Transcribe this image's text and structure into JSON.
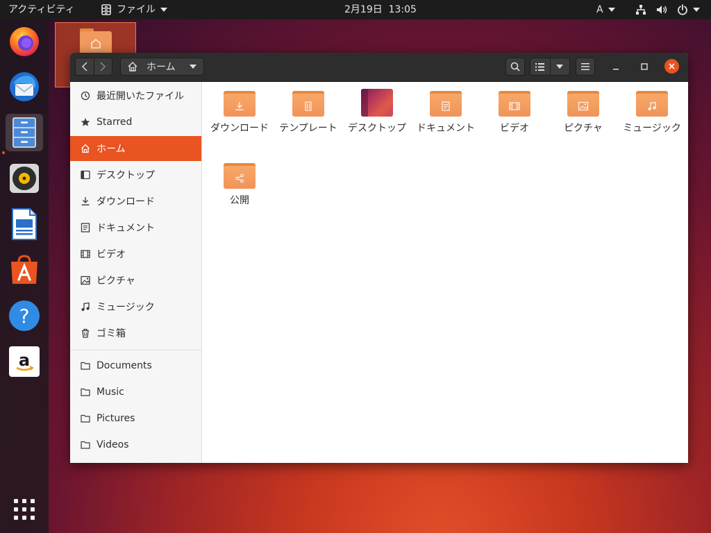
{
  "topbar": {
    "activities": "アクティビティ",
    "app_menu": "ファイル",
    "clock": "2月19日  13:05",
    "input_method": "A"
  },
  "dock": {
    "items": [
      {
        "icon": "firefox-icon"
      },
      {
        "icon": "thunderbird-icon"
      },
      {
        "icon": "files-icon",
        "active": true
      },
      {
        "icon": "rhythmbox-icon"
      },
      {
        "icon": "libreoffice-writer-icon"
      },
      {
        "icon": "ubuntu-software-icon"
      },
      {
        "icon": "help-icon"
      },
      {
        "icon": "amazon-icon"
      }
    ],
    "show_apps_icon": "app-grid-icon"
  },
  "window": {
    "location": "ホーム",
    "sidebar": {
      "items": [
        {
          "label": "最近開いたファイル",
          "icon": "recent-icon"
        },
        {
          "label": "Starred",
          "icon": "star-icon"
        },
        {
          "label": "ホーム",
          "icon": "home-icon",
          "selected": true
        },
        {
          "label": "デスクトップ",
          "icon": "desktop-icon"
        },
        {
          "label": "ダウンロード",
          "icon": "download-icon"
        },
        {
          "label": "ドキュメント",
          "icon": "document-icon"
        },
        {
          "label": "ビデオ",
          "icon": "video-icon"
        },
        {
          "label": "ピクチャ",
          "icon": "picture-icon"
        },
        {
          "label": "ミュージック",
          "icon": "music-icon"
        },
        {
          "label": "ゴミ箱",
          "icon": "trash-icon"
        },
        {
          "label": "Documents",
          "icon": "folder-icon"
        },
        {
          "label": "Music",
          "icon": "folder-icon"
        },
        {
          "label": "Pictures",
          "icon": "folder-icon"
        },
        {
          "label": "Videos",
          "icon": "folder-icon"
        }
      ]
    },
    "files": [
      {
        "label": "ダウンロード",
        "icon": "download-folder-icon"
      },
      {
        "label": "テンプレート",
        "icon": "templates-folder-icon"
      },
      {
        "label": "デスクトップ",
        "icon": "desktop-folder-icon"
      },
      {
        "label": "ドキュメント",
        "icon": "documents-folder-icon"
      },
      {
        "label": "ビデオ",
        "icon": "videos-folder-icon"
      },
      {
        "label": "ピクチャ",
        "icon": "pictures-folder-icon"
      },
      {
        "label": "ミュージック",
        "icon": "music-folder-icon"
      },
      {
        "label": "公開",
        "icon": "public-folder-icon"
      }
    ]
  },
  "colors": {
    "accent": "#e95420",
    "folder": "#f29a5e",
    "topbar": "#1c1c1c",
    "headerbar": "#2d2d2d"
  }
}
